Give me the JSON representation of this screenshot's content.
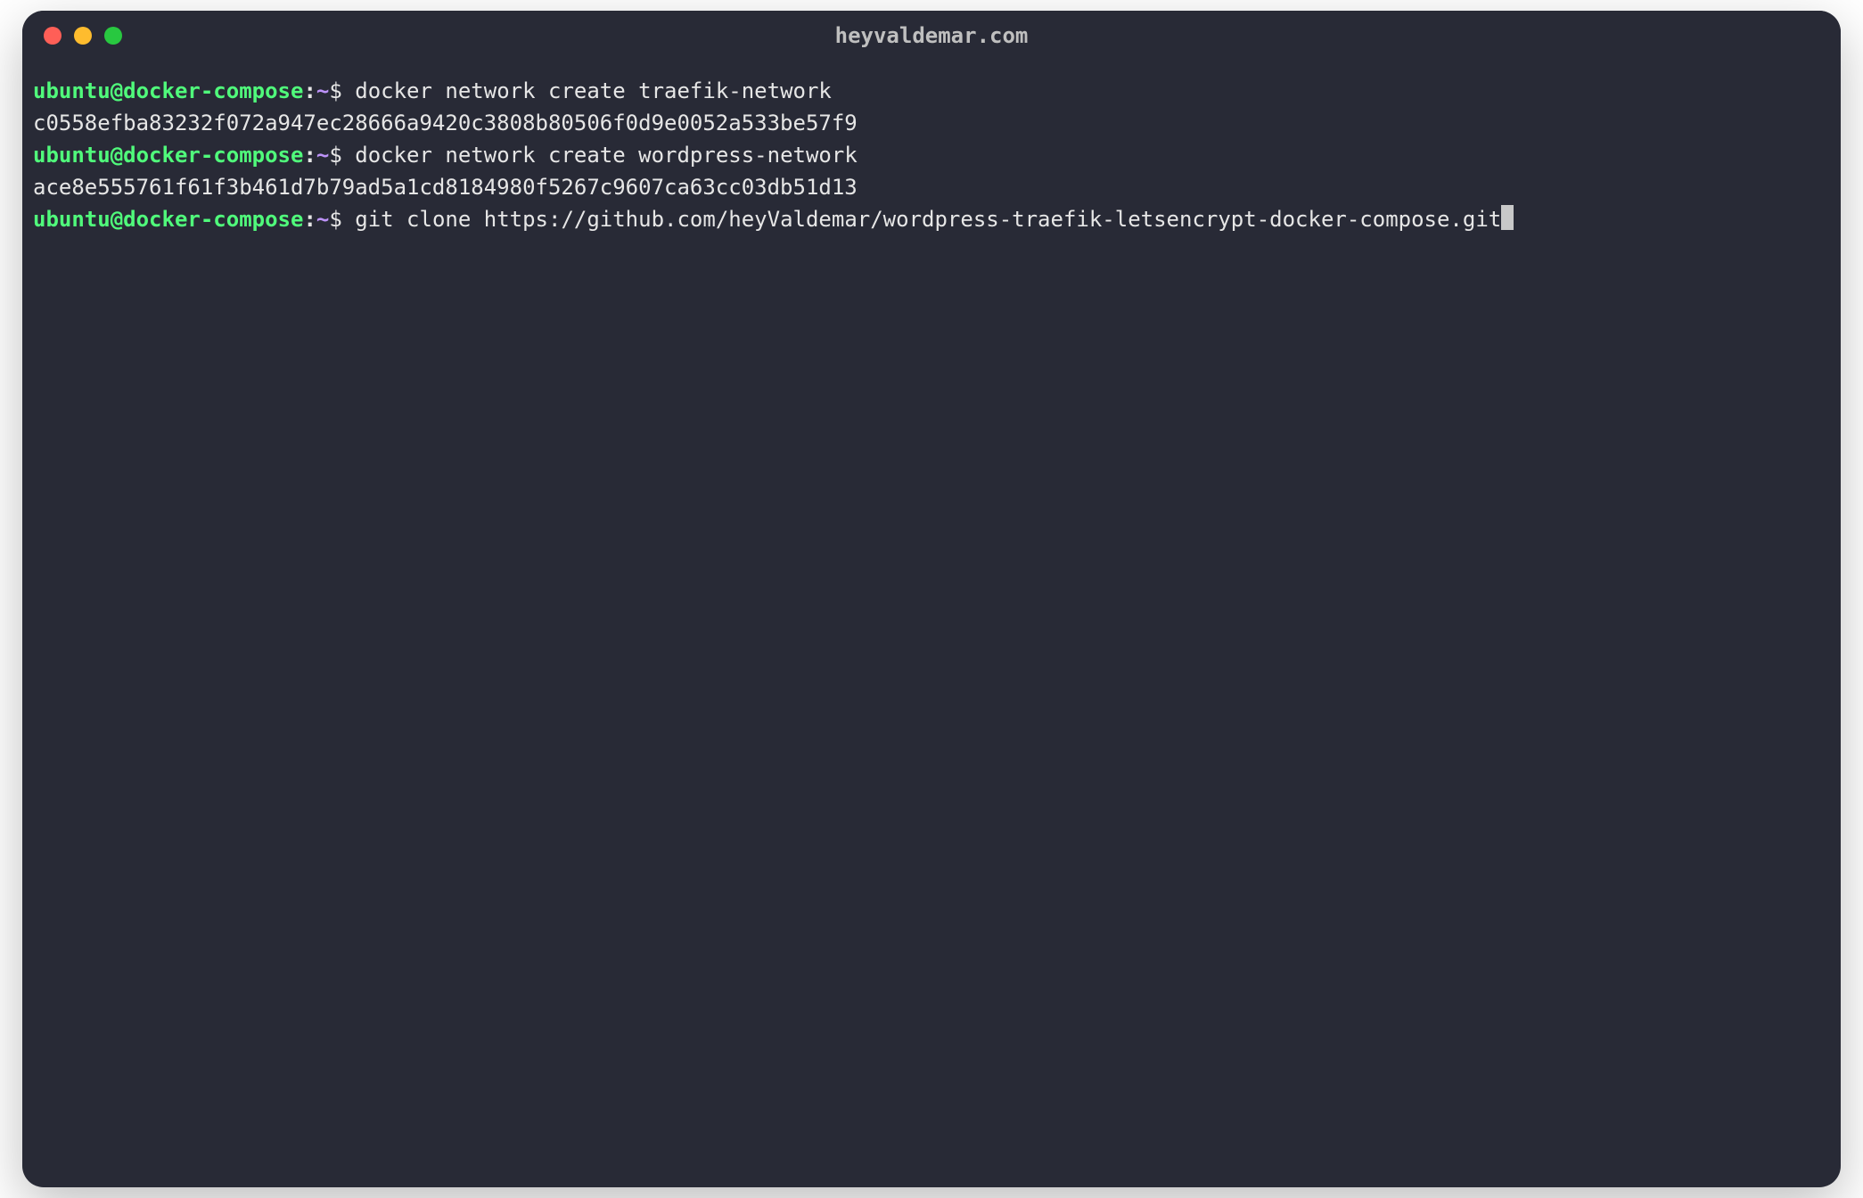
{
  "window": {
    "title": "heyvaldemar.com"
  },
  "colors": {
    "background": "#282a36",
    "text": "#e6e6e6",
    "prompt_user": "#50fa7b",
    "prompt_path": "#bd93f9",
    "traffic_red": "#ff5f57",
    "traffic_yellow": "#febc2e",
    "traffic_green": "#28c840",
    "cursor": "#c8c8c8"
  },
  "prompt": {
    "user_host": "ubuntu@docker-compose",
    "separator": ":",
    "path": "~",
    "symbol": "$"
  },
  "lines": [
    {
      "type": "cmd",
      "text": "docker network create traefik-network"
    },
    {
      "type": "output",
      "text": "c0558efba83232f072a947ec28666a9420c3808b80506f0d9e0052a533be57f9"
    },
    {
      "type": "cmd",
      "text": "docker network create wordpress-network"
    },
    {
      "type": "output",
      "text": "ace8e555761f61f3b461d7b79ad5a1cd8184980f5267c9607ca63cc03db51d13"
    },
    {
      "type": "cmd",
      "text": "git clone https://github.com/heyValdemar/wordpress-traefik-letsencrypt-docker-compose.git",
      "cursor": true
    }
  ]
}
